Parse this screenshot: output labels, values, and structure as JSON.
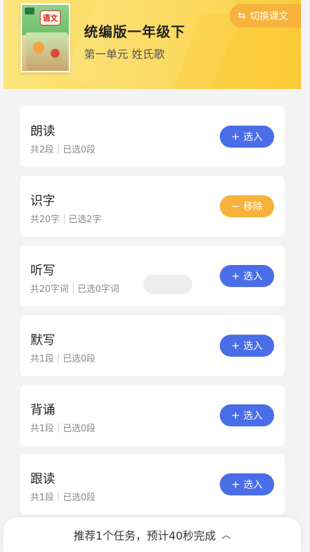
{
  "header": {
    "book_title": "统编版一年级下",
    "lesson": "第一单元 姓氏歌",
    "switch_label": "切换课文",
    "cover_text": "语文"
  },
  "tasks": [
    {
      "name": "朗读",
      "total": "共2段",
      "selected": "已选0段",
      "action": "选入",
      "action_type": "add"
    },
    {
      "name": "识字",
      "total": "共20字",
      "selected": "已选2字",
      "action": "移除",
      "action_type": "remove"
    },
    {
      "name": "听写",
      "total": "共20字词",
      "selected": "已选0字词",
      "action": "选入",
      "action_type": "add"
    },
    {
      "name": "默写",
      "total": "共1段",
      "selected": "已选0段",
      "action": "选入",
      "action_type": "add"
    },
    {
      "name": "背诵",
      "total": "共1段",
      "selected": "已选0段",
      "action": "选入",
      "action_type": "add"
    },
    {
      "name": "跟读",
      "total": "共1段",
      "selected": "已选0段",
      "action": "选入",
      "action_type": "add"
    }
  ],
  "bottom_bar": {
    "summary": "推荐1个任务，预计40秒完成"
  },
  "colors": {
    "add": "#4a6ee8",
    "remove": "#f7b23c",
    "header_yellow": "#fcd856"
  },
  "icons": {
    "switch": "swap-arrows-icon",
    "add": "plus-icon",
    "remove": "minus-icon",
    "expand": "chevron-up-icon"
  }
}
